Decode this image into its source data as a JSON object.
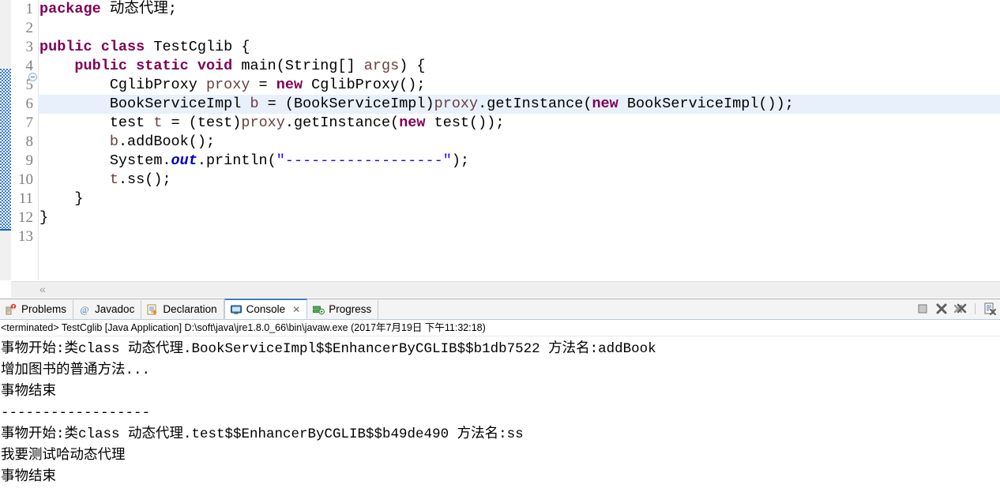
{
  "editor": {
    "line_numbers": [
      "1",
      "2",
      "3",
      "4",
      "5",
      "6",
      "7",
      "8",
      "9",
      "10",
      "11",
      "12",
      "13"
    ],
    "fold_marker": "collapse-icon",
    "highlighted_line": 6,
    "colors": {
      "keyword": "#7f0055",
      "string": "#2a00ff",
      "local_variable": "#6a3e3e",
      "static_field": "#0000c0",
      "line_highlight": "#e8f0fb",
      "change_bar": "#3a7bd5"
    },
    "lines": [
      {
        "n": "1",
        "tokens": [
          {
            "t": "kw",
            "s": "package"
          },
          {
            "t": "pln",
            "s": " 动态代理;"
          }
        ]
      },
      {
        "n": "2",
        "tokens": []
      },
      {
        "n": "3",
        "tokens": [
          {
            "t": "kw",
            "s": "public class"
          },
          {
            "t": "pln",
            "s": " TestCglib {"
          }
        ]
      },
      {
        "n": "4",
        "tokens": [
          {
            "t": "pln",
            "s": "    "
          },
          {
            "t": "kw",
            "s": "public static void"
          },
          {
            "t": "pln",
            "s": " main(String[] "
          },
          {
            "t": "var",
            "s": "args"
          },
          {
            "t": "pln",
            "s": ") {"
          }
        ]
      },
      {
        "n": "5",
        "tokens": [
          {
            "t": "pln",
            "s": "        CglibProxy "
          },
          {
            "t": "var",
            "s": "proxy"
          },
          {
            "t": "pln",
            "s": " = "
          },
          {
            "t": "kw",
            "s": "new"
          },
          {
            "t": "pln",
            "s": " CglibProxy();"
          }
        ]
      },
      {
        "n": "6",
        "tokens": [
          {
            "t": "pln",
            "s": "        BookServiceImpl "
          },
          {
            "t": "var",
            "s": "b"
          },
          {
            "t": "pln",
            "s": " = (BookServiceImpl)"
          },
          {
            "t": "var",
            "s": "proxy"
          },
          {
            "t": "pln",
            "s": ".getInstance("
          },
          {
            "t": "kw",
            "s": "new"
          },
          {
            "t": "pln",
            "s": " BookServiceImpl());"
          }
        ]
      },
      {
        "n": "7",
        "tokens": [
          {
            "t": "pln",
            "s": "        test "
          },
          {
            "t": "var",
            "s": "t"
          },
          {
            "t": "pln",
            "s": " = (test)"
          },
          {
            "t": "var",
            "s": "proxy"
          },
          {
            "t": "pln",
            "s": ".getInstance("
          },
          {
            "t": "kw",
            "s": "new"
          },
          {
            "t": "pln",
            "s": " test());"
          }
        ]
      },
      {
        "n": "8",
        "tokens": [
          {
            "t": "pln",
            "s": "        "
          },
          {
            "t": "var",
            "s": "b"
          },
          {
            "t": "pln",
            "s": ".addBook();"
          }
        ]
      },
      {
        "n": "9",
        "tokens": [
          {
            "t": "pln",
            "s": "        System."
          },
          {
            "t": "fld",
            "s": "out"
          },
          {
            "t": "pln",
            "s": ".println("
          },
          {
            "t": "str",
            "s": "\"------------------\""
          },
          {
            "t": "pln",
            "s": ");"
          }
        ]
      },
      {
        "n": "10",
        "tokens": [
          {
            "t": "pln",
            "s": "        "
          },
          {
            "t": "var",
            "s": "t"
          },
          {
            "t": "pln",
            "s": ".ss();"
          }
        ]
      },
      {
        "n": "11",
        "tokens": [
          {
            "t": "pln",
            "s": "    }"
          }
        ]
      },
      {
        "n": "12",
        "tokens": [
          {
            "t": "pln",
            "s": "}"
          }
        ]
      },
      {
        "n": "13",
        "tokens": []
      }
    ],
    "hscroll_chevron": "«"
  },
  "panel": {
    "tabs": [
      {
        "label": "Problems",
        "icon": "problems-icon",
        "active": false,
        "closable": false
      },
      {
        "label": "Javadoc",
        "icon": "javadoc-icon",
        "active": false,
        "closable": false
      },
      {
        "label": "Declaration",
        "icon": "declaration-icon",
        "active": false,
        "closable": false
      },
      {
        "label": "Console",
        "icon": "console-icon",
        "active": true,
        "closable": true
      },
      {
        "label": "Progress",
        "icon": "progress-icon",
        "active": false,
        "closable": false
      }
    ],
    "close_glyph": "✕",
    "toolbar": [
      {
        "name": "terminate-button",
        "icon": "stop-square-icon"
      },
      {
        "name": "remove-launch-button",
        "icon": "remove-x-icon"
      },
      {
        "name": "remove-all-launches-button",
        "icon": "remove-all-xx-icon"
      },
      {
        "name": "open-console-button",
        "icon": "console-page-icon"
      }
    ],
    "run_status": "<terminated> TestCglib [Java Application] D:\\soft\\java\\jre1.8.0_66\\bin\\javaw.exe (2017年7月19日 下午11:32:18)",
    "output": [
      "事物开始:类class 动态代理.BookServiceImpl$$EnhancerByCGLIB$$b1db7522 方法名:addBook",
      "增加图书的普通方法...",
      "事物结束",
      "------------------",
      "事物开始:类class 动态代理.test$$EnhancerByCGLIB$$b49de490 方法名:ss",
      "我要测试哈动态代理",
      "事物结束"
    ]
  }
}
